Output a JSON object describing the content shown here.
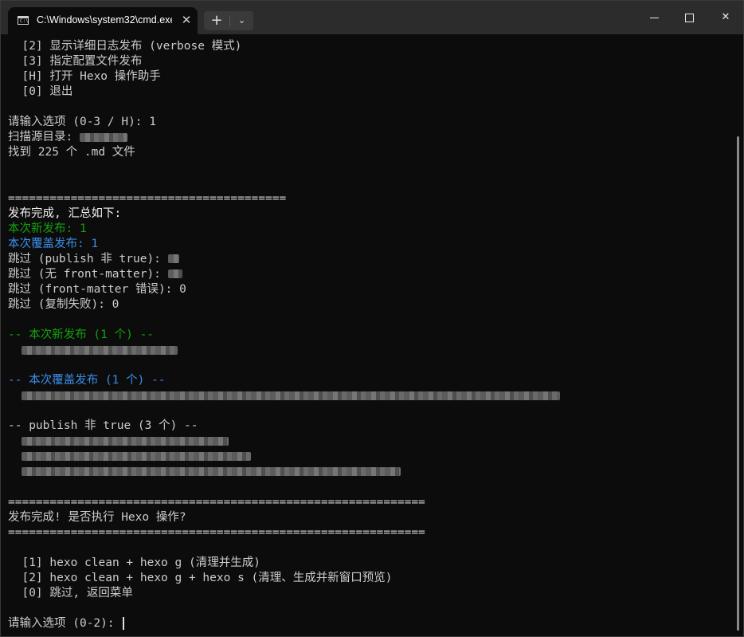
{
  "titlebar": {
    "tab_title": "C:\\Windows\\system32\\cmd.exe",
    "tab_icon_text": "C:\\",
    "tab_close": "✕",
    "new_tab": "+",
    "dropdown": "⌄",
    "minimize": "",
    "maximize": "",
    "close": "✕"
  },
  "terminal": {
    "lines": [
      {
        "text": "  [2] 显示详细日志发布 (verbose 模式)",
        "color": "default"
      },
      {
        "text": "  [3] 指定配置文件发布",
        "color": "default"
      },
      {
        "text": "  [H] 打开 Hexo 操作助手",
        "color": "default"
      },
      {
        "text": "  [0] 退出",
        "color": "default"
      },
      {
        "text": "",
        "color": "default"
      },
      {
        "text": "请输入选项 (0-3 / H): 1",
        "color": "default"
      },
      {
        "text": "扫描源目录: ",
        "color": "default",
        "redacted": 60
      },
      {
        "text": "找到 225 个 .md 文件",
        "color": "default"
      },
      {
        "text": "",
        "color": "default"
      },
      {
        "text": "",
        "color": "default"
      },
      {
        "text": "========================================",
        "color": "default"
      },
      {
        "text": "发布完成, 汇总如下:",
        "color": "white"
      },
      {
        "text": "本次新发布: 1",
        "color": "green"
      },
      {
        "text": "本次覆盖发布: 1",
        "color": "blue"
      },
      {
        "text": "跳过 (publish 非 true): ",
        "color": "default",
        "redacted": 14
      },
      {
        "text": "跳过 (无 front-matter): ",
        "color": "default",
        "redacted": 18
      },
      {
        "text": "跳过 (front-matter 错误): 0",
        "color": "default"
      },
      {
        "text": "跳过 (复制失败): 0",
        "color": "default"
      },
      {
        "text": "",
        "color": "default"
      },
      {
        "text": "-- 本次新发布 (1 个) --",
        "color": "green"
      },
      {
        "text": "  ",
        "color": "default",
        "redacted": 196
      },
      {
        "text": "",
        "color": "default"
      },
      {
        "text": "-- 本次覆盖发布 (1 个) --",
        "color": "blue"
      },
      {
        "text": "  ",
        "color": "default",
        "redacted": 676
      },
      {
        "text": "",
        "color": "default"
      },
      {
        "text": "-- publish 非 true (3 个) --",
        "color": "default"
      },
      {
        "text": "  ",
        "color": "default",
        "redacted": 260
      },
      {
        "text": "  ",
        "color": "default",
        "redacted": 288
      },
      {
        "text": "  ",
        "color": "default",
        "redacted": 476
      },
      {
        "text": "",
        "color": "default"
      },
      {
        "text": "============================================================",
        "color": "default"
      },
      {
        "text": "发布完成! 是否执行 Hexo 操作?",
        "color": "default"
      },
      {
        "text": "============================================================",
        "color": "default"
      },
      {
        "text": "",
        "color": "default"
      },
      {
        "text": "  [1] hexo clean + hexo g (清理并生成)",
        "color": "default"
      },
      {
        "text": "  [2] hexo clean + hexo g + hexo s (清理、生成并新窗口预览)",
        "color": "default"
      },
      {
        "text": "  [0] 跳过, 返回菜单",
        "color": "default"
      },
      {
        "text": "",
        "color": "default"
      },
      {
        "text": "请输入选项 (0-2): ",
        "color": "default",
        "cursor": true
      }
    ]
  }
}
